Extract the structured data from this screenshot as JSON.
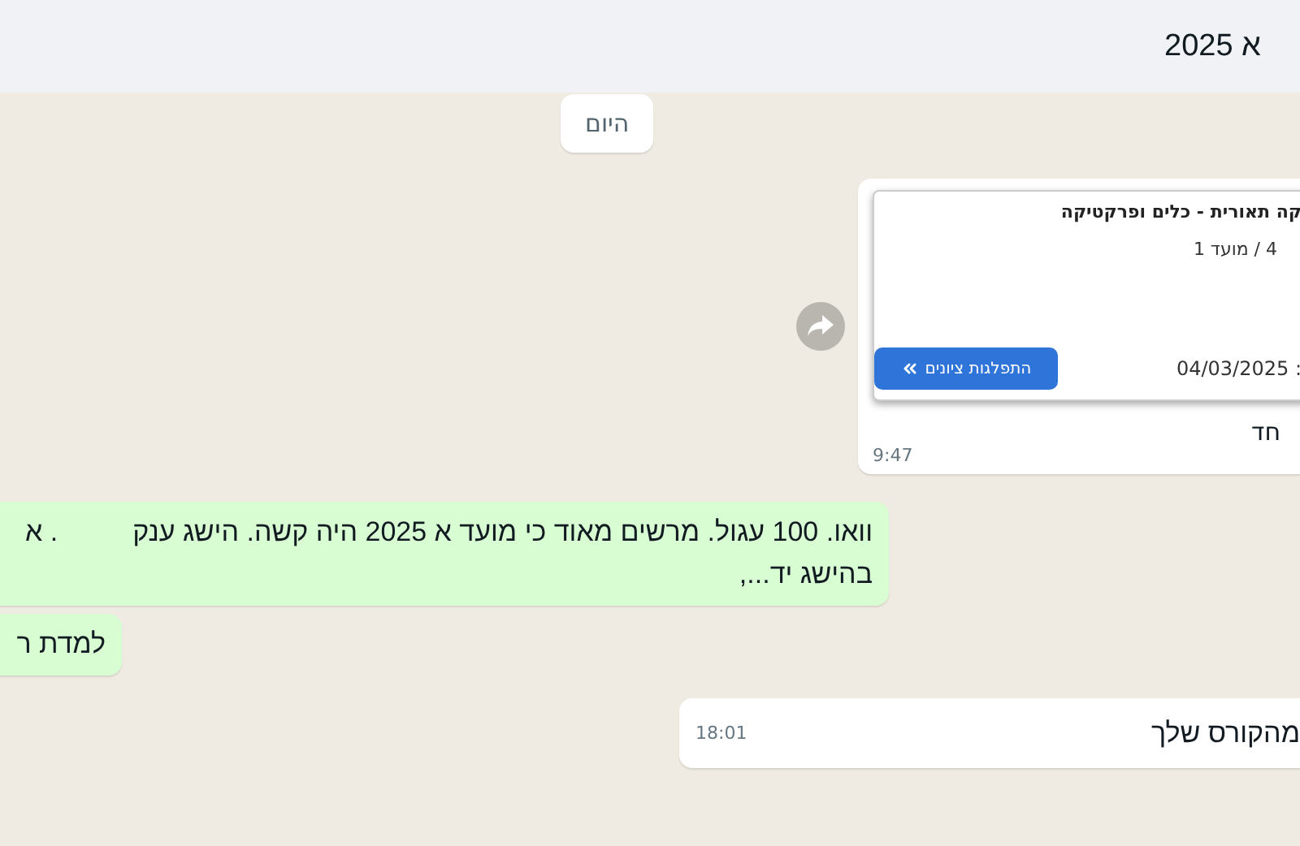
{
  "header": {
    "title": "א 2025"
  },
  "date_chip": "היום",
  "messages": [
    {
      "kind": "card",
      "outgoing": false,
      "card": {
        "title": "קה תאורית - כלים ופרקטיקה",
        "subtitle": "4 / מועד 1",
        "date": ": 04/03/2025",
        "button": "התפלגות ציונים"
      },
      "text": "חד",
      "time": "9:47"
    },
    {
      "kind": "text",
      "outgoing": true,
      "lines": [
        [
          "וואו. 100 עגול. מרשים מאוד כי מועד א 2025 היה קשה. הישג ענק",
          ". א"
        ],
        [
          "בהישג יד...,"
        ]
      ]
    },
    {
      "kind": "text",
      "outgoing": true,
      "lines": [
        [
          "למדת ר"
        ]
      ]
    },
    {
      "kind": "text",
      "outgoing": false,
      "lines": [
        [
          "מהקורס שלך"
        ]
      ],
      "time": "18:01"
    }
  ]
}
